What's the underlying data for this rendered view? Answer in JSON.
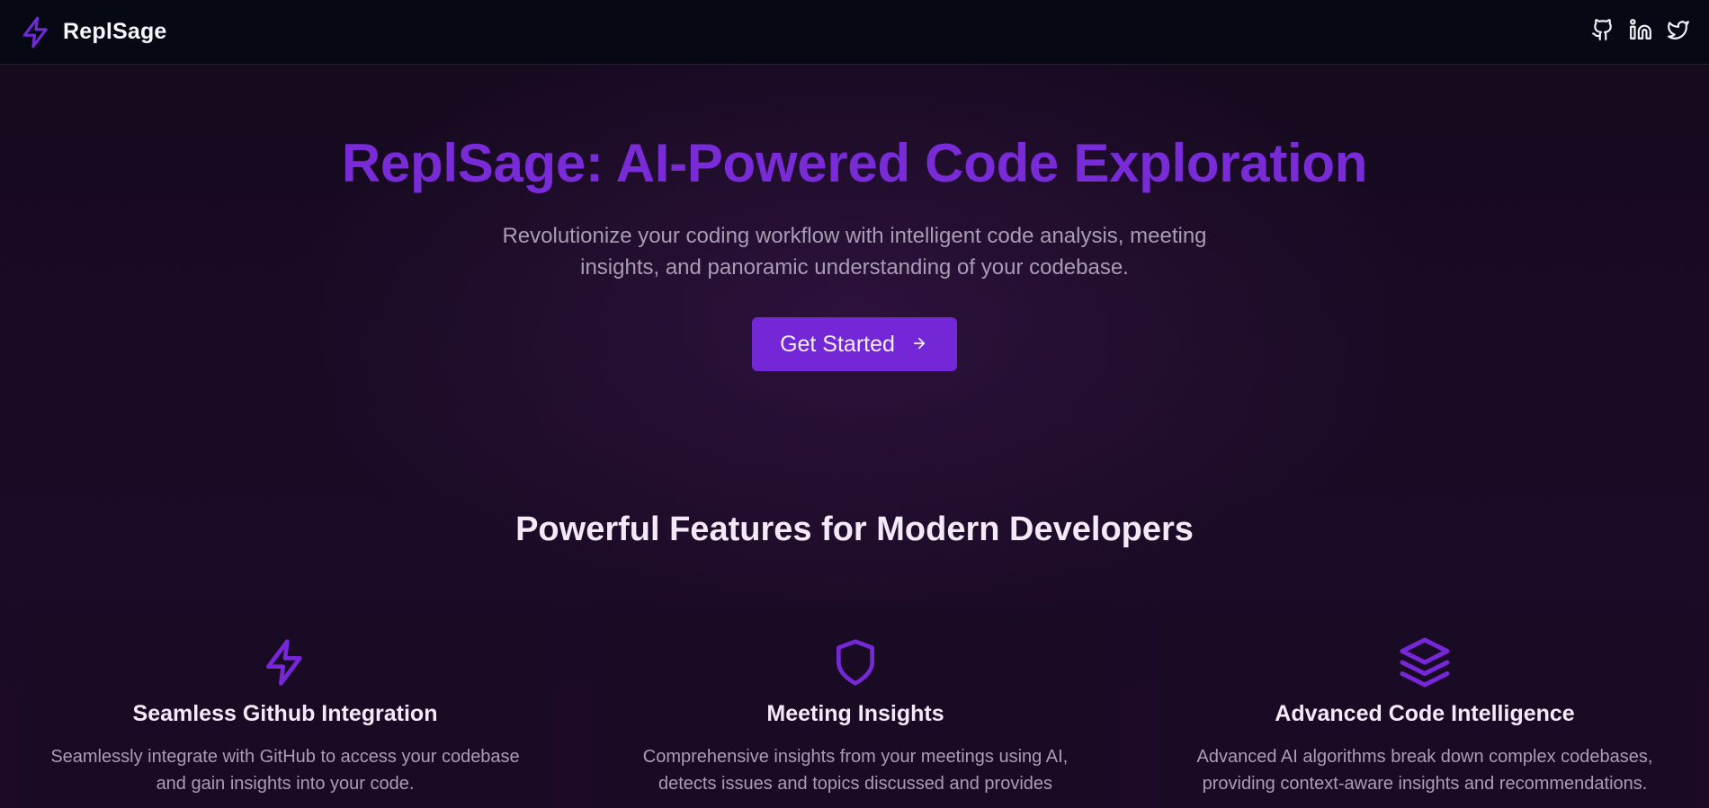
{
  "app": {
    "brand": "ReplSage"
  },
  "nav": {
    "social": [
      {
        "icon": "github-icon"
      },
      {
        "icon": "linkedin-icon"
      },
      {
        "icon": "twitter-icon"
      }
    ]
  },
  "hero": {
    "title": "ReplSage: AI-Powered Code Exploration",
    "subtitle": "Revolutionize your coding workflow with intelligent code analysis, meeting insights, and panoramic understanding of your codebase.",
    "cta_label": "Get Started"
  },
  "features": {
    "heading": "Powerful Features for Modern Developers",
    "items": [
      {
        "icon": "lightning-icon",
        "title": "Seamless Github Integration",
        "description": "Seamlessly integrate with GitHub to access your codebase and gain insights into your code."
      },
      {
        "icon": "shield-icon",
        "title": "Meeting Insights",
        "description": "Comprehensive insights from your meetings using AI, detects issues and topics discussed and provides"
      },
      {
        "icon": "layers-icon",
        "title": "Advanced Code Intelligence",
        "description": "Advanced AI algorithms break down complex codebases, providing context-aware insights and recommendations."
      }
    ]
  },
  "colors": {
    "accent": "#7a2bd8",
    "button": "#7427d6",
    "navbar": "#060914",
    "background": "#15091f",
    "card": "#1a0b25",
    "muted_text": "#a89db5"
  }
}
